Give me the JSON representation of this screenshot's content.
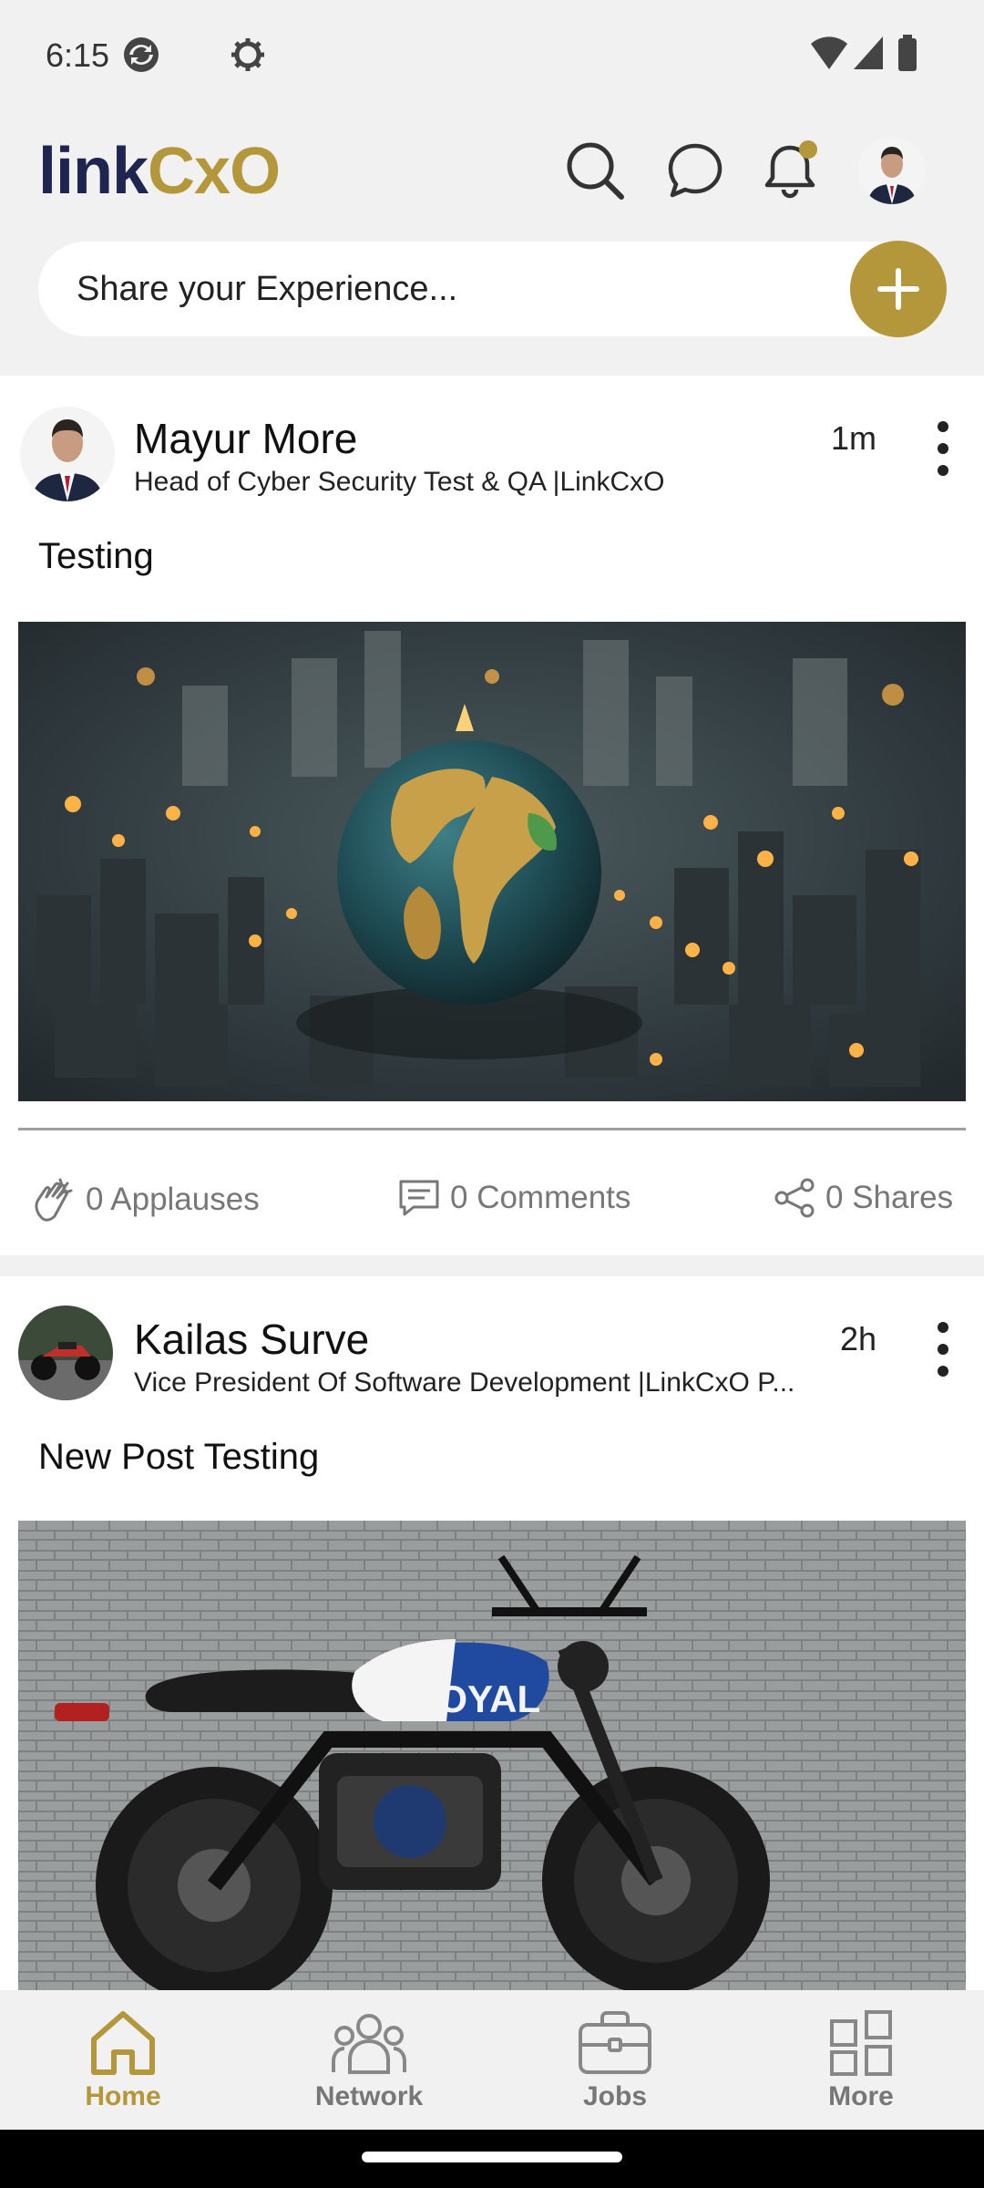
{
  "status": {
    "time": "6:15"
  },
  "app": {
    "logo_part1": "link",
    "logo_part2": "CxO",
    "share_placeholder": "Share your Experience...",
    "colors": {
      "brand_gold": "#b3973a",
      "brand_navy": "#1d2550"
    }
  },
  "posts": [
    {
      "author": "Mayur More",
      "title": "Head of Cyber Security Test & QA |LinkCxO",
      "time": "1m",
      "text": "Testing",
      "image_desc": "globe-city-image",
      "applauses": "0 Applauses",
      "comments": "0 Comments",
      "shares": "0 Shares"
    },
    {
      "author": "Kailas Surve",
      "title": "Vice President Of Software Development |LinkCxO P...",
      "time": "2h",
      "text": "New  Post Testing",
      "image_desc": "motorcycle-image",
      "image_brand": "ROYAL"
    }
  ],
  "bottom_nav": [
    {
      "label": "Home",
      "icon": "home-icon",
      "active": true
    },
    {
      "label": "Network",
      "icon": "network-icon",
      "active": false
    },
    {
      "label": "Jobs",
      "icon": "briefcase-icon",
      "active": false
    },
    {
      "label": "More",
      "icon": "grid-icon",
      "active": false
    }
  ]
}
